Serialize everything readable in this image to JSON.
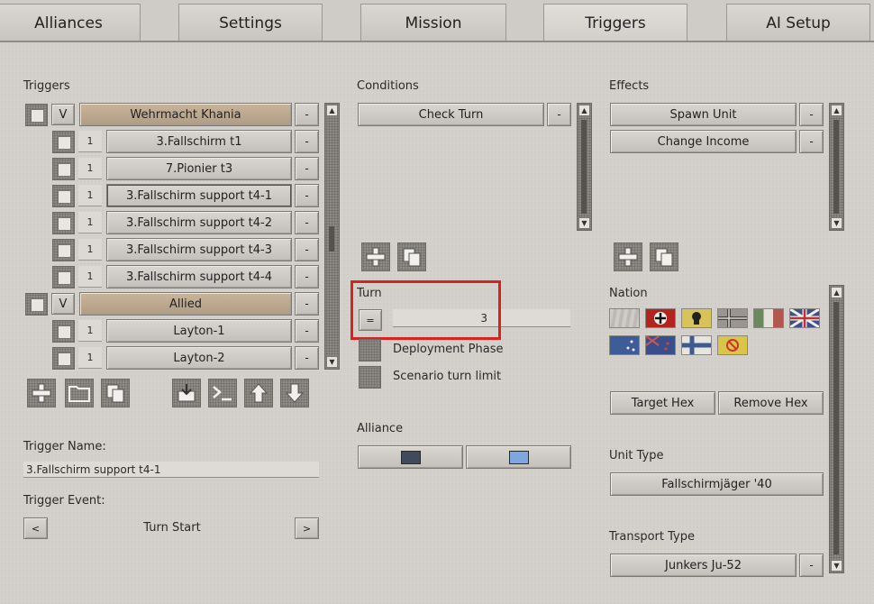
{
  "tabs": [
    "Alliances",
    "Settings",
    "Mission",
    "Triggers",
    "AI Setup"
  ],
  "active_tab": "Triggers",
  "triggers": {
    "heading": "Triggers",
    "items": [
      {
        "num": "V",
        "label": "Wehrmacht Khania",
        "group": true
      },
      {
        "num": "1",
        "label": "3.Fallschirm t1",
        "group": false
      },
      {
        "num": "1",
        "label": "7.Pionier t3",
        "group": false
      },
      {
        "num": "1",
        "label": "3.Fallschirm support t4-1",
        "group": false
      },
      {
        "num": "1",
        "label": "3.Fallschirm support t4-2",
        "group": false
      },
      {
        "num": "1",
        "label": "3.Fallschirm support t4-3",
        "group": false
      },
      {
        "num": "1",
        "label": "3.Fallschirm support t4-4",
        "group": false
      },
      {
        "num": "V",
        "label": "Allied",
        "group": true
      },
      {
        "num": "1",
        "label": "Layton-1",
        "group": false
      },
      {
        "num": "1",
        "label": "Layton-2",
        "group": false
      }
    ],
    "remove_label": "-",
    "toolbar_icons": [
      "add-icon",
      "folder-icon",
      "copy-icon",
      "import-icon",
      "console-icon",
      "arrow-up-icon",
      "arrow-down-icon"
    ],
    "name_label": "Trigger Name:",
    "name_value": "3.Fallschirm support t4-1",
    "event_label": "Trigger Event:",
    "event_value": "Turn Start",
    "prev_label": "<",
    "next_label": ">"
  },
  "conditions": {
    "heading": "Conditions",
    "items": [
      "Check Turn"
    ],
    "remove_label": "-",
    "turn_label": "Turn",
    "operator": "=",
    "turn_value": "3",
    "deployment_label": "Deployment Phase",
    "scenario_limit_label": "Scenario turn limit",
    "alliance_label": "Alliance",
    "alliance_colors": [
      "#3f4b5c",
      "#7ea6e0"
    ]
  },
  "effects": {
    "heading": "Effects",
    "items": [
      "Spawn Unit",
      "Change Income"
    ],
    "remove_label": "-",
    "nation_label": "Nation",
    "nations": [
      "blank",
      "germany-ss",
      "totenkopf",
      "norway-style",
      "italy",
      "uk",
      "australia",
      "new-zealand",
      "finland",
      "none"
    ],
    "target_hex_label": "Target Hex",
    "remove_hex_label": "Remove Hex",
    "unit_type_label": "Unit Type",
    "unit_type_value": "Fallschirmjäger '40",
    "transport_type_label": "Transport Type",
    "transport_type_value": "Junkers Ju-52"
  },
  "colors": {
    "highlight": "#d9211f",
    "group_row": "#c7b49a"
  }
}
